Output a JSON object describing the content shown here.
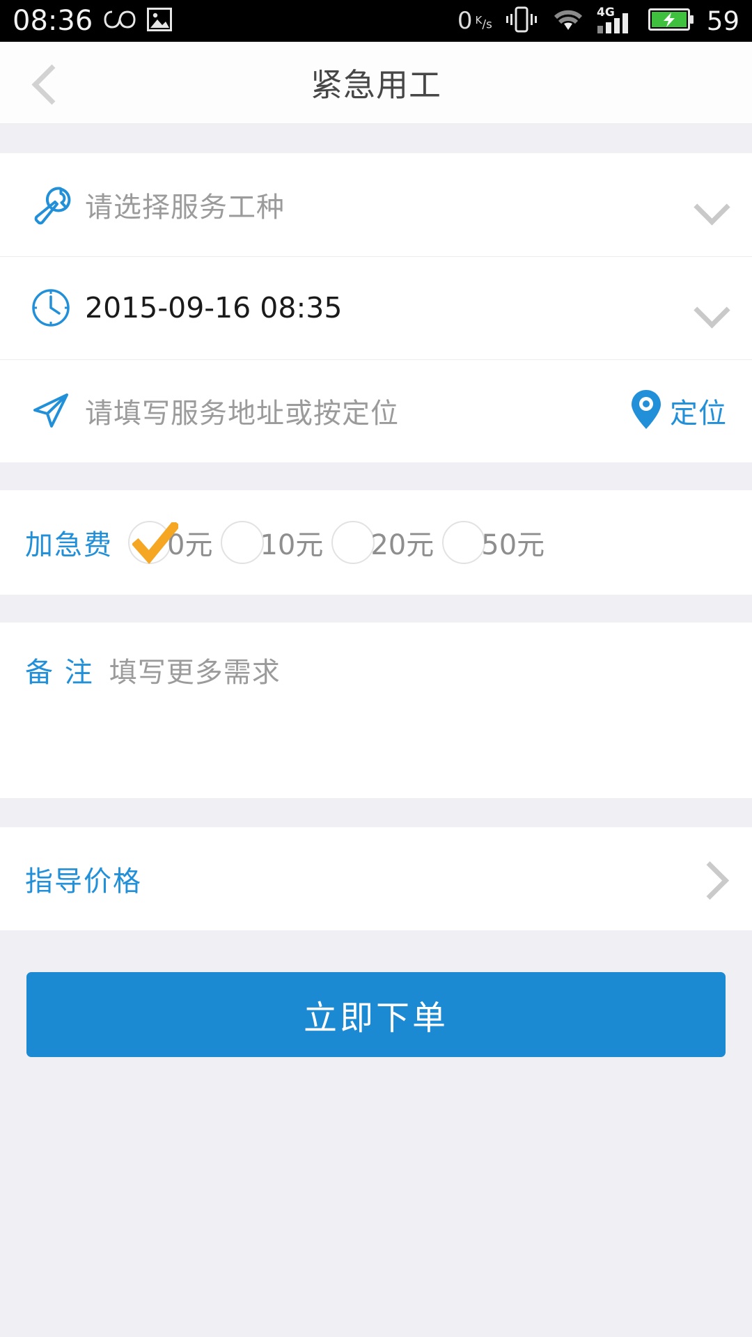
{
  "statusbar": {
    "time": "08:36",
    "infinity_icon": "infinity-icon",
    "image_icon": "image-icon",
    "net_speed_value": "0",
    "net_speed_unit_num": "K",
    "net_speed_unit_den": "s",
    "vibrate_icon": "vibrate-icon",
    "wifi_icon": "wifi-icon",
    "signal_label": "4G",
    "signal_icon": "signal-bars-icon",
    "battery_icon": "battery-charging-icon",
    "battery_percent": "59"
  },
  "navbar": {
    "back_icon": "chevron-left-icon",
    "title": "紧急用工"
  },
  "form": {
    "job": {
      "icon": "wrench-icon",
      "placeholder": "请选择服务工种",
      "chevron": "chevron-down-icon"
    },
    "time": {
      "icon": "clock-icon",
      "value": "2015-09-16 08:35",
      "chevron": "chevron-down-icon"
    },
    "address": {
      "icon": "navigation-arrow-icon",
      "placeholder": "请填写服务地址或按定位",
      "locate_icon": "map-pin-icon",
      "locate_label": "定位"
    }
  },
  "fee": {
    "label": "加急费",
    "options": [
      {
        "label": "0元",
        "selected": true
      },
      {
        "label": "10元",
        "selected": false
      },
      {
        "label": "20元",
        "selected": false
      },
      {
        "label": "50元",
        "selected": false
      }
    ],
    "check_color": "#f5a623"
  },
  "remark": {
    "label": "备  注",
    "placeholder": "填写更多需求"
  },
  "guide_price": {
    "label": "指导价格",
    "chevron": "chevron-right-icon"
  },
  "submit": {
    "label": "立即下单"
  },
  "colors": {
    "accent_blue": "#2190d8",
    "button_blue": "#1b8ad2",
    "page_bg": "#efeff4",
    "card_bg": "#ffffff",
    "muted_text": "#9b9b9b"
  }
}
